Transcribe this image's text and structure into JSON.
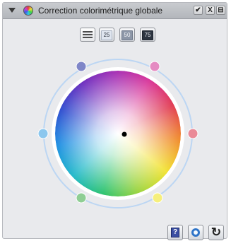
{
  "window": {
    "title": "Correction colorimétrique globale",
    "buttons": [
      {
        "name": "check-button",
        "glyph": "✔"
      },
      {
        "name": "close-button",
        "glyph": "X"
      },
      {
        "name": "menu-button",
        "glyph": "⊟"
      }
    ]
  },
  "toolbar": {
    "mode_label": "",
    "levels": [
      "25",
      "50",
      "75"
    ]
  },
  "wheel": {
    "outer_ring_color": "#bcd6f3",
    "handles": [
      {
        "name": "handle-blue",
        "color": "#7f86c8"
      },
      {
        "name": "handle-magenta",
        "color": "#e58bc2"
      },
      {
        "name": "handle-red",
        "color": "#ea8a97"
      },
      {
        "name": "handle-yellow",
        "color": "#f6ef7c"
      },
      {
        "name": "handle-green",
        "color": "#8fce94"
      },
      {
        "name": "handle-cyan",
        "color": "#8cc7ee"
      }
    ]
  },
  "footer": {
    "help_glyph": "?",
    "eyedropper_glyph": "",
    "reset_glyph": "↻"
  }
}
